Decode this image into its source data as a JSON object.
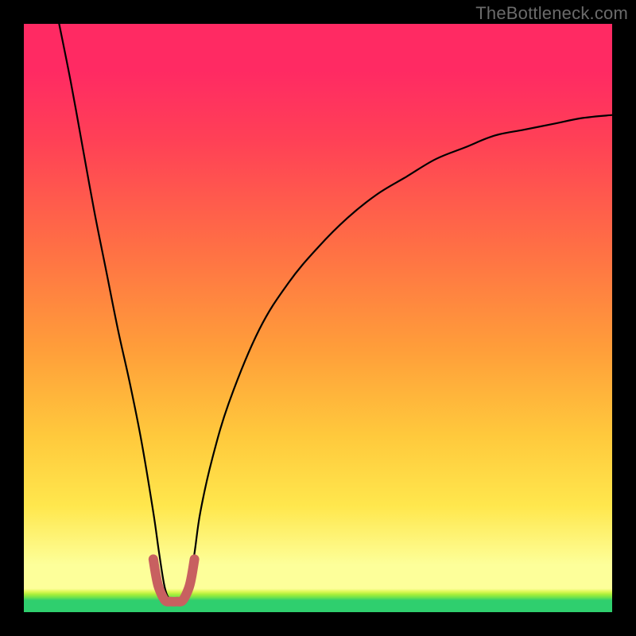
{
  "watermark": "TheBottleneck.com",
  "chart_data": {
    "type": "line",
    "title": "",
    "xlabel": "",
    "ylabel": "",
    "xlim": [
      0,
      100
    ],
    "ylim": [
      0,
      100
    ],
    "series": [
      {
        "name": "bottleneck-curve",
        "x": [
          6,
          8,
          10,
          12,
          14,
          16,
          18,
          20,
          22,
          23,
          24,
          25,
          26,
          27,
          28,
          29,
          30,
          32,
          35,
          40,
          45,
          50,
          55,
          60,
          65,
          70,
          75,
          80,
          85,
          90,
          95,
          100
        ],
        "values": [
          100,
          90,
          79,
          68,
          58,
          48,
          39,
          29,
          17,
          10,
          4,
          2,
          2,
          2,
          4,
          10,
          17,
          26,
          36,
          48,
          56,
          62,
          67,
          71,
          74,
          77,
          79,
          81,
          82,
          83,
          84,
          84.5
        ]
      },
      {
        "name": "sweet-spot-marker",
        "x": [
          22,
          22.5,
          23,
          24,
          25,
          26,
          27,
          28,
          28.5,
          29
        ],
        "values": [
          9,
          6,
          4,
          2,
          1.8,
          1.8,
          2,
          4,
          6,
          9
        ]
      }
    ],
    "colors": {
      "curve": "#000000",
      "marker": "#c86060",
      "gradient_top": "#ff2a63",
      "gradient_bottom": "#2fcf6e"
    }
  }
}
